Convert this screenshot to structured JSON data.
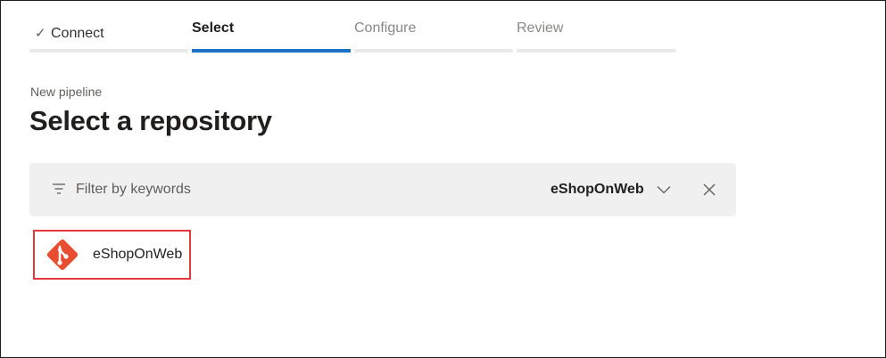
{
  "wizard": {
    "steps": [
      {
        "label": "Connect",
        "state": "done"
      },
      {
        "label": "Select",
        "state": "active"
      },
      {
        "label": "Configure",
        "state": "pending"
      },
      {
        "label": "Review",
        "state": "pending"
      }
    ]
  },
  "header": {
    "eyebrow": "New pipeline",
    "title": "Select a repository"
  },
  "filter": {
    "placeholder": "Filter by keywords",
    "value": "",
    "selected_scope": "eShopOnWeb"
  },
  "repositories": [
    {
      "name": "eShopOnWeb",
      "icon": "git-icon",
      "highlighted": true
    }
  ],
  "colors": {
    "accent": "#1a73c7",
    "git_brand": "#e84d31",
    "highlight_border": "#e5383b"
  }
}
